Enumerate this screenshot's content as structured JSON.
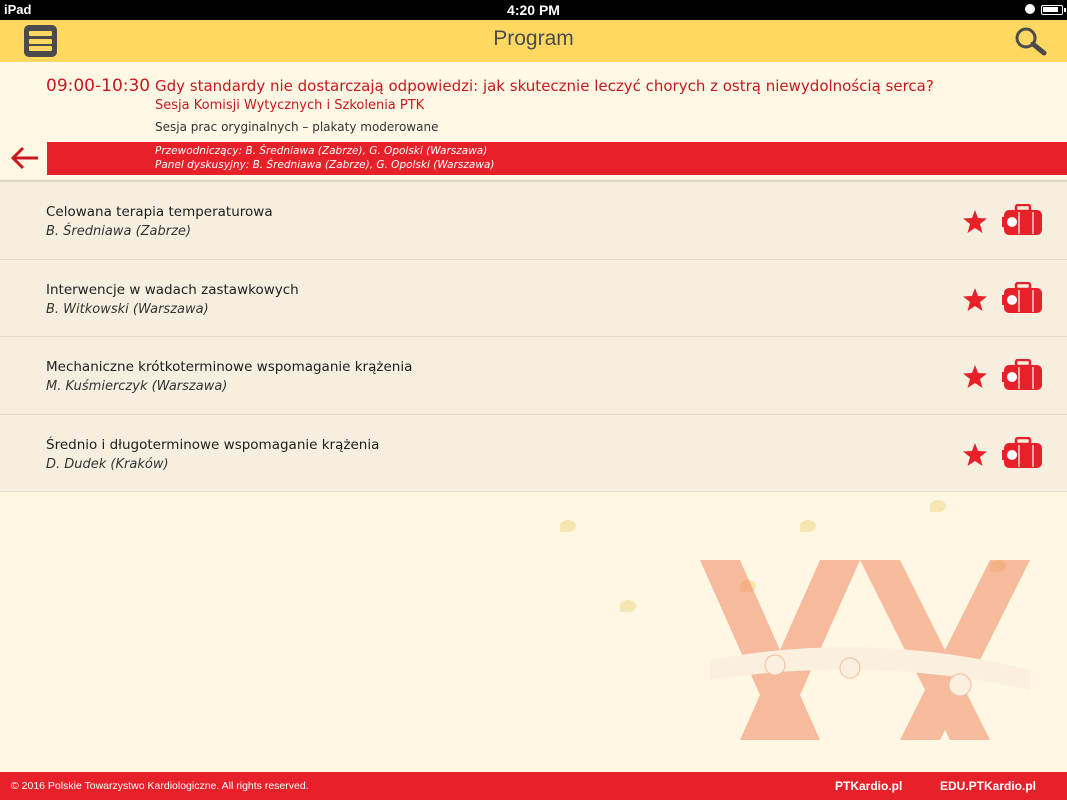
{
  "status_bar": {
    "device": "iPad",
    "time": "4:20 PM"
  },
  "header": {
    "title": "Program",
    "menu_icon": "hamburger-menu-icon",
    "search_icon": "search-icon"
  },
  "session": {
    "time": "09:00-10:30",
    "title": "Gdy standardy nie dostarczają odpowiedzi: jak skutecznie leczyć chorych z ostrą niewydolnością serca?",
    "subtitle": "Sesja Komisji Wytycznych i Szkolenia PTK",
    "type": "Sesja prac oryginalnych – plakaty moderowane",
    "chairs": "Przewodniczący: B. Średniawa (Zabrze), G. Opolski (Warszawa)",
    "panel": "Panel dyskusyjny: B. Średniawa (Zabrze), G. Opolski (Warszawa)"
  },
  "talks": [
    {
      "title": "Celowana terapia temperaturowa",
      "author": "B. Średniawa (Zabrze)"
    },
    {
      "title": "Interwencje w wadach zastawkowych",
      "author": "B. Witkowski (Warszawa)"
    },
    {
      "title": "Mechaniczne krótkoterminowe wspomaganie krążenia",
      "author": "M. Kuśmierczyk (Warszawa)"
    },
    {
      "title": "Średnio i długoterminowe wspomaganie krążenia",
      "author": "D. Dudek (Kraków)"
    }
  ],
  "footer": {
    "copyright": "© 2016 Polskie Towarzystwo Kardiologiczne. All rights reserved.",
    "link1": "PTKardio.pl",
    "link2": "EDU.PTKardio.pl"
  },
  "colors": {
    "accent": "#e8202a",
    "nav": "#ffd862",
    "session_text": "#c8181f",
    "background": "#fdf7e3"
  }
}
